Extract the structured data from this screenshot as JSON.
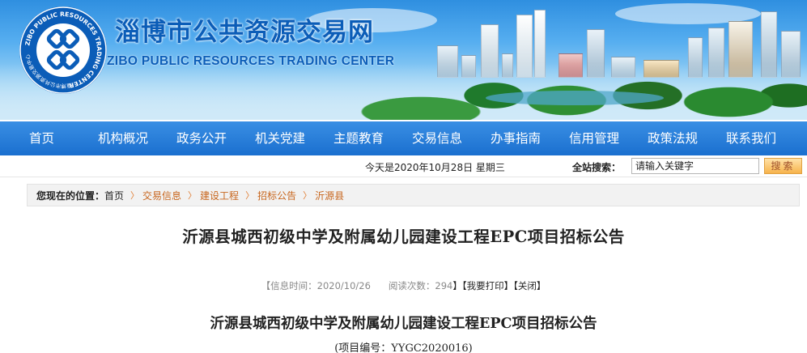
{
  "header": {
    "title_cn": "淄博市公共资源交易网",
    "title_en": "ZIBO PUBLIC RESOURCES TRADING CENTER",
    "logo_ring_text": "ZIBO PUBLIC RESOURCES TRADING CENTER",
    "logo_ring_text_cn": "淄博市公共资源交易中心"
  },
  "nav": {
    "items": [
      {
        "label": "首页"
      },
      {
        "label": "机构概况"
      },
      {
        "label": "政务公开"
      },
      {
        "label": "机关党建"
      },
      {
        "label": "主题教育"
      },
      {
        "label": "交易信息"
      },
      {
        "label": "办事指南"
      },
      {
        "label": "信用管理"
      },
      {
        "label": "政策法规"
      },
      {
        "label": "联系我们"
      }
    ]
  },
  "infobar": {
    "date_text": "今天是2020年10月28日 星期三",
    "search_label": "全站搜索：",
    "search_placeholder": "请输入关键字",
    "search_button": "搜索"
  },
  "breadcrumb": {
    "lead": "您现在的位置：",
    "home": "首页",
    "items": [
      "交易信息",
      "建设工程",
      "招标公告",
      "沂源县"
    ],
    "separator": "〉"
  },
  "article": {
    "title": "沂源县城西初级中学及附属幼儿园建设工程EPC项目招标公告",
    "meta": {
      "info_time_label": "【信息时间：",
      "info_time_value": "2020/10/26",
      "views_label": "阅读次数：",
      "views_value": "294",
      "print_label": "】【我要打印】",
      "close_label": "【关闭】"
    },
    "doc_heading": "沂源县城西初级中学及附属幼儿园建设工程EPC项目招标公告",
    "project_code": "(项目编号：YYGC2020016)"
  },
  "colors": {
    "brand_blue": "#0b5db8",
    "nav_blue": "#1a6fcf",
    "breadcrumb_link": "#c8671f",
    "search_button": "#f7b34c"
  }
}
